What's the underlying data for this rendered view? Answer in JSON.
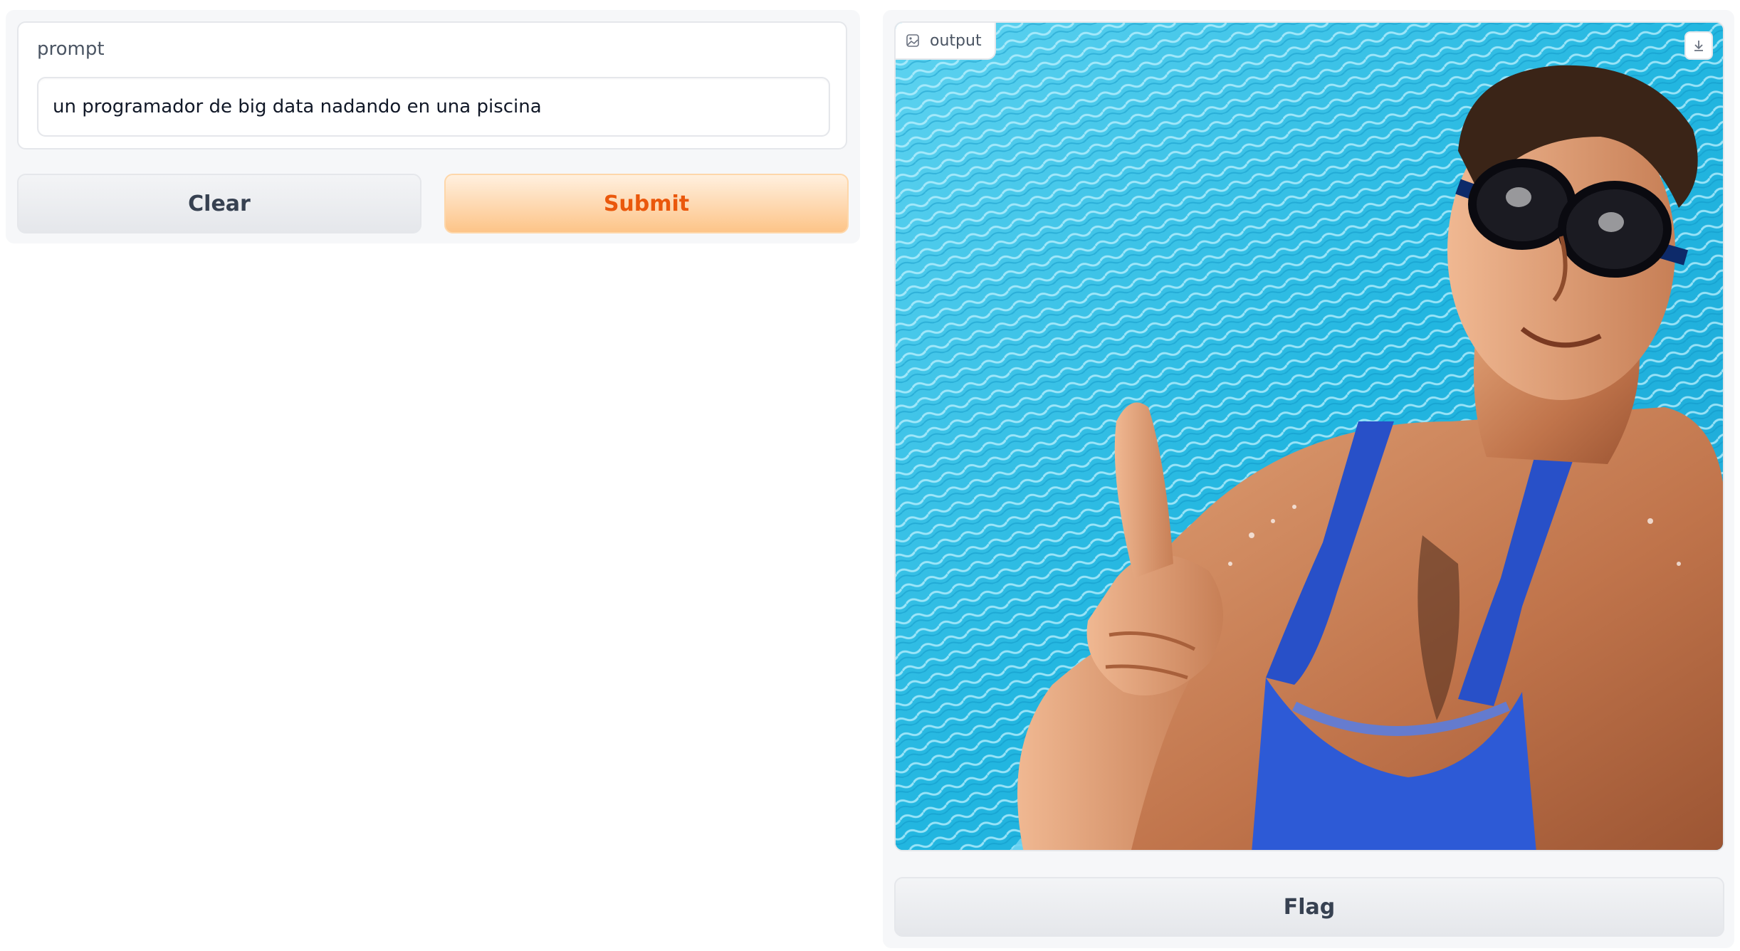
{
  "input": {
    "label": "prompt",
    "value": "un programador de big data nadando en una piscina"
  },
  "actions": {
    "clear_label": "Clear",
    "submit_label": "Submit",
    "flag_label": "Flag"
  },
  "output": {
    "label": "output",
    "image_icon": "image-icon",
    "download_icon": "download-icon"
  },
  "colors": {
    "accent": "#ea580c",
    "pool": "#2bbde3"
  }
}
